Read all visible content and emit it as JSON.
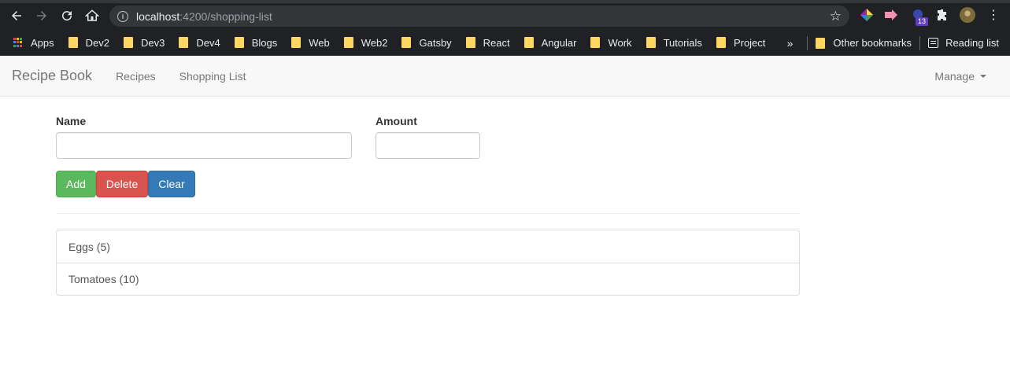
{
  "browser": {
    "url_host": "localhost",
    "url_path": ":4200/shopping-list",
    "extension_badge": "13",
    "bookmarks": [
      "Apps",
      "Dev2",
      "Dev3",
      "Dev4",
      "Blogs",
      "Web",
      "Web2",
      "Gatsby",
      "React",
      "Angular",
      "Work",
      "Tutorials",
      "Project"
    ],
    "overflow_label": "»",
    "other_bookmarks": "Other bookmarks",
    "reading_list": "Reading list"
  },
  "navbar": {
    "brand": "Recipe Book",
    "links": [
      "Recipes",
      "Shopping List"
    ],
    "manage": "Manage"
  },
  "form": {
    "name_label": "Name",
    "amount_label": "Amount",
    "name_value": "",
    "amount_value": "",
    "add_label": "Add",
    "delete_label": "Delete",
    "clear_label": "Clear"
  },
  "shopping_list": [
    {
      "text": "Eggs (5)"
    },
    {
      "text": "Tomatoes (10)"
    }
  ],
  "colors": {
    "success": "#5cb85c",
    "danger": "#d9534f",
    "primary": "#337ab7",
    "chrome_dark": "#202124"
  }
}
